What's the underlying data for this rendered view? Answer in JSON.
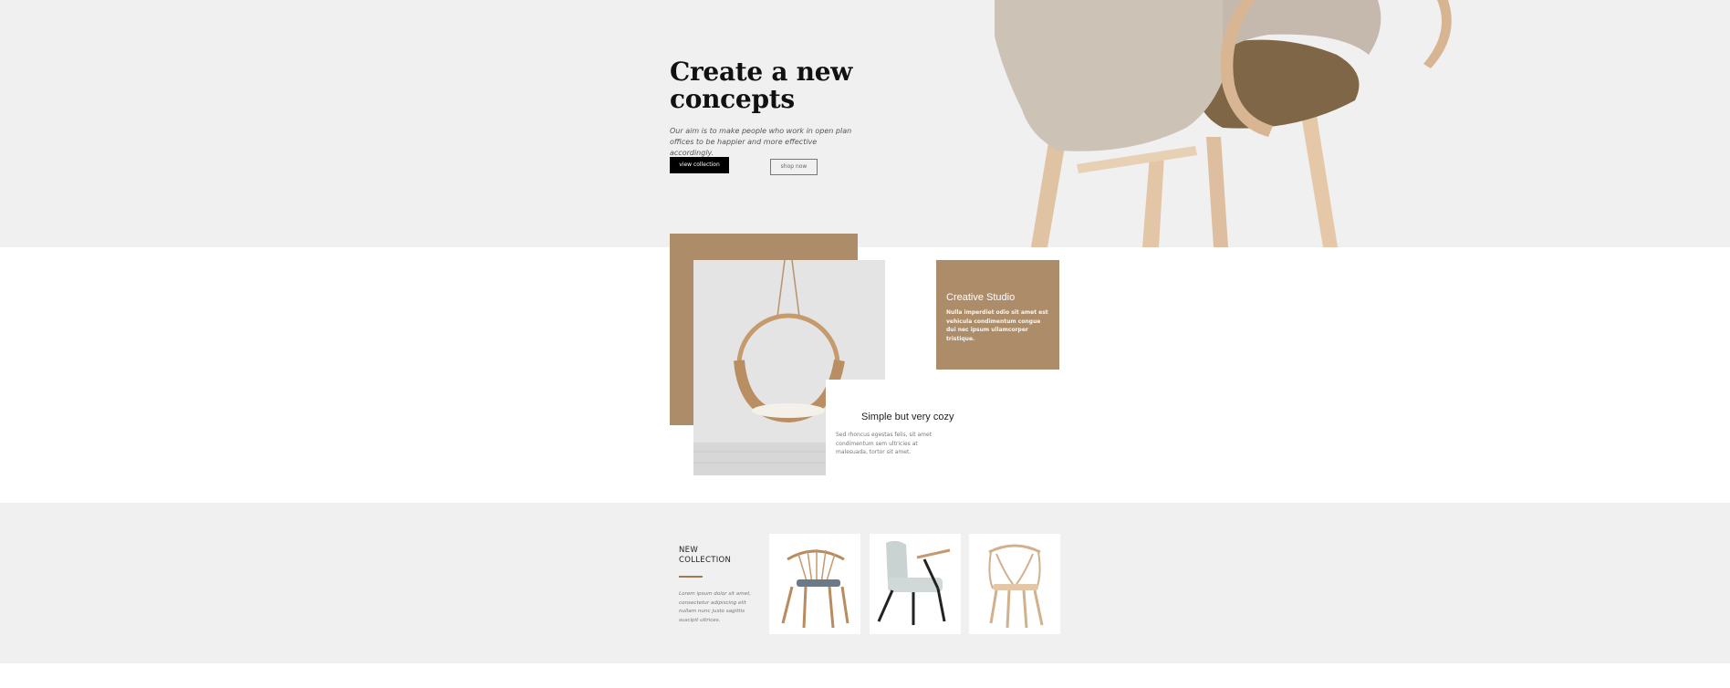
{
  "hero": {
    "title": "Create a new concepts",
    "text": "Our aim is to make people who work in open plan offices to be happier and more effective accordingly.",
    "primary_button": "view collection",
    "secondary_button": "shop now",
    "image_icon": "armchair-photo"
  },
  "about": {
    "image_icon": "hanging-swing-chair-photo",
    "card": {
      "title": "Creative Studio",
      "text": "Nulla imperdiet odio sit amet est vehicula condimentum congue dui nec ipsum ullamcorper tristique."
    },
    "feature": {
      "title": "Simple but very cozy",
      "text": "Sed rhoncus egestas felis, sit amet condimentum sem ultricies at malesuada, tortor sit amet."
    }
  },
  "collection": {
    "heading_line1": "NEW",
    "heading_line2": "COLLECTION",
    "text": "Lorem ipsum dolor sit amet, consectetur adipiscing elit nullam nunc justo sagittis suscipit ultrices.",
    "products": [
      {
        "icon": "wooden-chair-photo"
      },
      {
        "icon": "lounge-chair-photo"
      },
      {
        "icon": "wishbone-chair-photo"
      }
    ]
  },
  "colors": {
    "hero_background": "#f0f0f0",
    "accent_brown": "#ad8c6a",
    "button_black": "#000000"
  }
}
